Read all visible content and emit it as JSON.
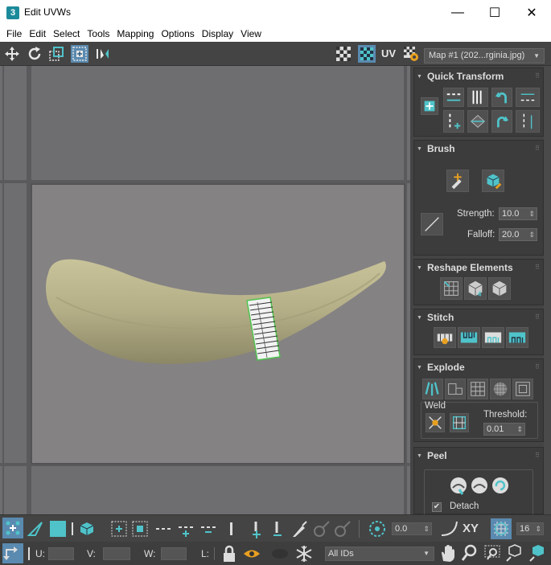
{
  "window": {
    "app_icon": "3",
    "title": "Edit UVWs",
    "minimize": "—",
    "maximize": "☐",
    "close": "✕"
  },
  "menu": [
    "File",
    "Edit",
    "Select",
    "Tools",
    "Mapping",
    "Options",
    "Display",
    "View"
  ],
  "toolbar": {
    "uv_label": "UV",
    "map_select": "Map #1 (202...rginia.jpg)"
  },
  "panel": {
    "quick_transform": {
      "title": "Quick Transform"
    },
    "brush": {
      "title": "Brush",
      "strength_label": "Strength:",
      "strength_value": "10.0",
      "falloff_label": "Falloff:",
      "falloff_value": "20.0"
    },
    "reshape": {
      "title": "Reshape Elements"
    },
    "stitch": {
      "title": "Stitch"
    },
    "explode": {
      "title": "Explode",
      "weld_label": "Weld",
      "threshold_label": "Threshold:",
      "threshold_value": "0.01"
    },
    "peel": {
      "title": "Peel",
      "detach_label": "Detach",
      "detach_checked": true
    }
  },
  "bottom": {
    "angle_value": "0.0",
    "xy_label": "XY",
    "grid_value": "16",
    "u_label": "U:",
    "v_label": "V:",
    "w_label": "W:",
    "l_label": "L:",
    "ids_select": "All IDs"
  },
  "colors": {
    "accent": "#4fc3c9",
    "selection": "#4fc34f",
    "panel_bg": "#444444",
    "viewport_bg": "#6e6d70"
  }
}
